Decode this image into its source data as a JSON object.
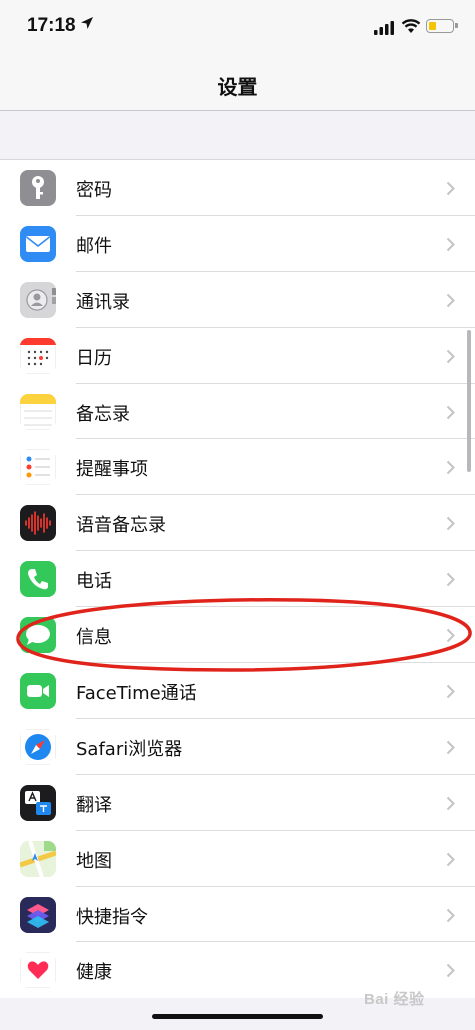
{
  "status_bar": {
    "time": "17:18",
    "icons": [
      "location-arrow-icon",
      "cellular-signal-icon",
      "wifi-icon",
      "battery-icon"
    ],
    "battery_color": "#f5c400"
  },
  "nav": {
    "title": "设置"
  },
  "rows": [
    {
      "label": "密码",
      "icon": "key-icon"
    },
    {
      "label": "邮件",
      "icon": "mail-icon"
    },
    {
      "label": "通讯录",
      "icon": "contacts-icon"
    },
    {
      "label": "日历",
      "icon": "calendar-icon"
    },
    {
      "label": "备忘录",
      "icon": "notes-icon"
    },
    {
      "label": "提醒事项",
      "icon": "reminders-icon"
    },
    {
      "label": "语音备忘录",
      "icon": "voice-memos-icon"
    },
    {
      "label": "电话",
      "icon": "phone-icon"
    },
    {
      "label": "信息",
      "icon": "messages-icon"
    },
    {
      "label": "FaceTime通话",
      "icon": "facetime-icon"
    },
    {
      "label": "Safari浏览器",
      "icon": "safari-icon"
    },
    {
      "label": "翻译",
      "icon": "translate-icon"
    },
    {
      "label": "地图",
      "icon": "maps-icon"
    },
    {
      "label": "快捷指令",
      "icon": "shortcuts-icon"
    },
    {
      "label": "健康",
      "icon": "health-icon"
    }
  ],
  "annotation": {
    "highlighted_row": "信息",
    "color": "#e0231b"
  },
  "watermark": {
    "text": "Bai 经验"
  }
}
